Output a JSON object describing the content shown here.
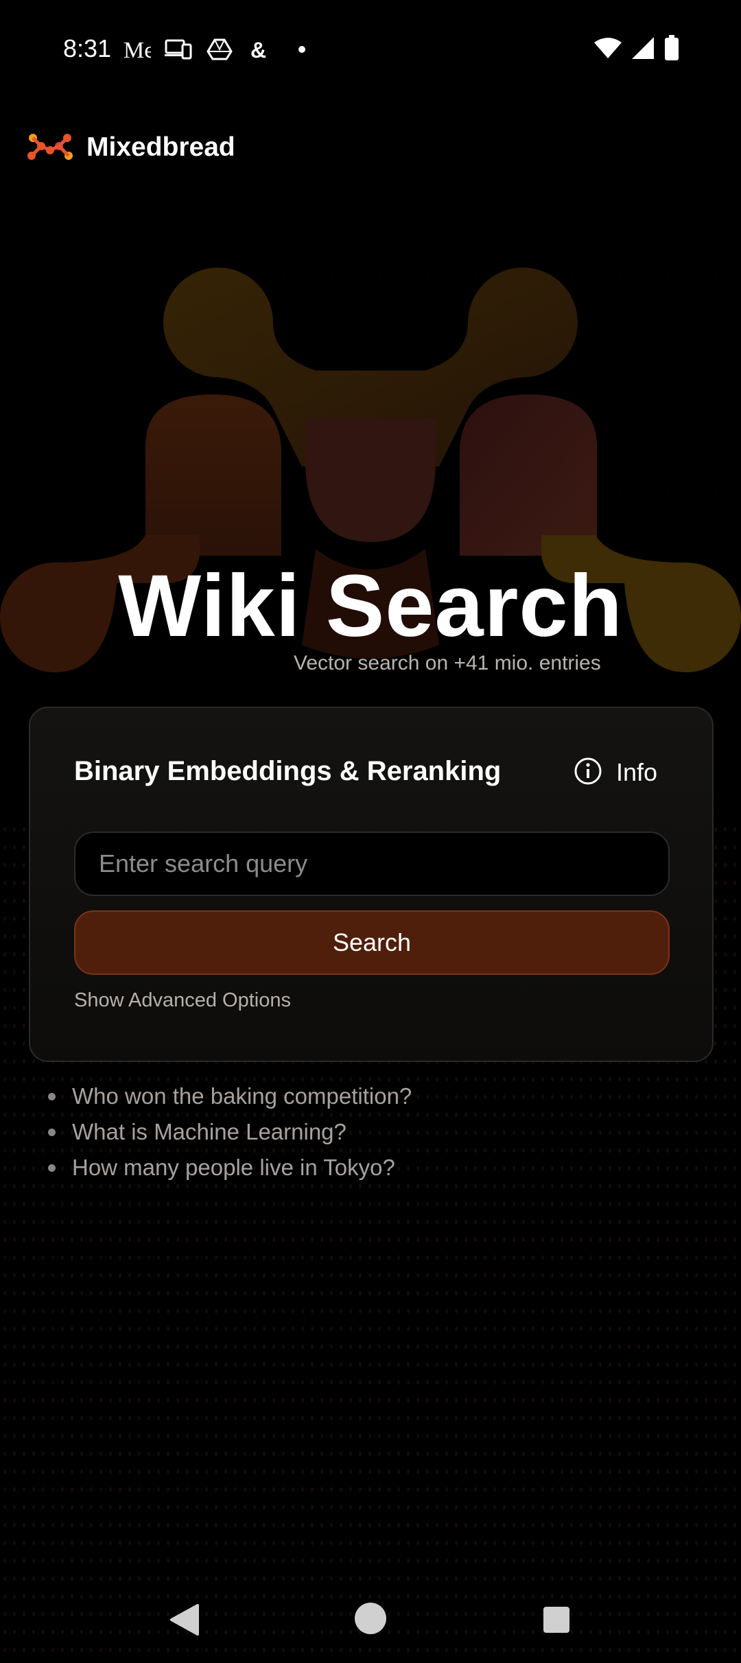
{
  "status_bar": {
    "time": "8:31",
    "left_icons": [
      "messages-icon",
      "devices-icon",
      "drive-icon",
      "threads-icon",
      "dot-icon"
    ],
    "right_icons": [
      "wifi-icon",
      "signal-icon",
      "battery-icon"
    ]
  },
  "header": {
    "brand": "Mixedbread",
    "logo_colors": [
      "#e8542a",
      "#f2a01e",
      "#d6325a"
    ]
  },
  "hero": {
    "title": "Wiki Search",
    "subtitle": "Vector search on +41 mio. entries",
    "logo_colors": [
      "#3f2a07",
      "#3d1a0a",
      "#35141a",
      "#4a3004"
    ]
  },
  "search_card": {
    "title": "Binary Embeddings & Reranking",
    "info_label": "Info",
    "input": {
      "value": "",
      "placeholder": "Enter search query"
    },
    "search_label": "Search",
    "advanced_label": "Show Advanced Options",
    "accent": "#4f1f0b"
  },
  "suggestions": [
    "Who won the baking competition?",
    "What is Machine Learning?",
    "How many people live in Tokyo?"
  ]
}
